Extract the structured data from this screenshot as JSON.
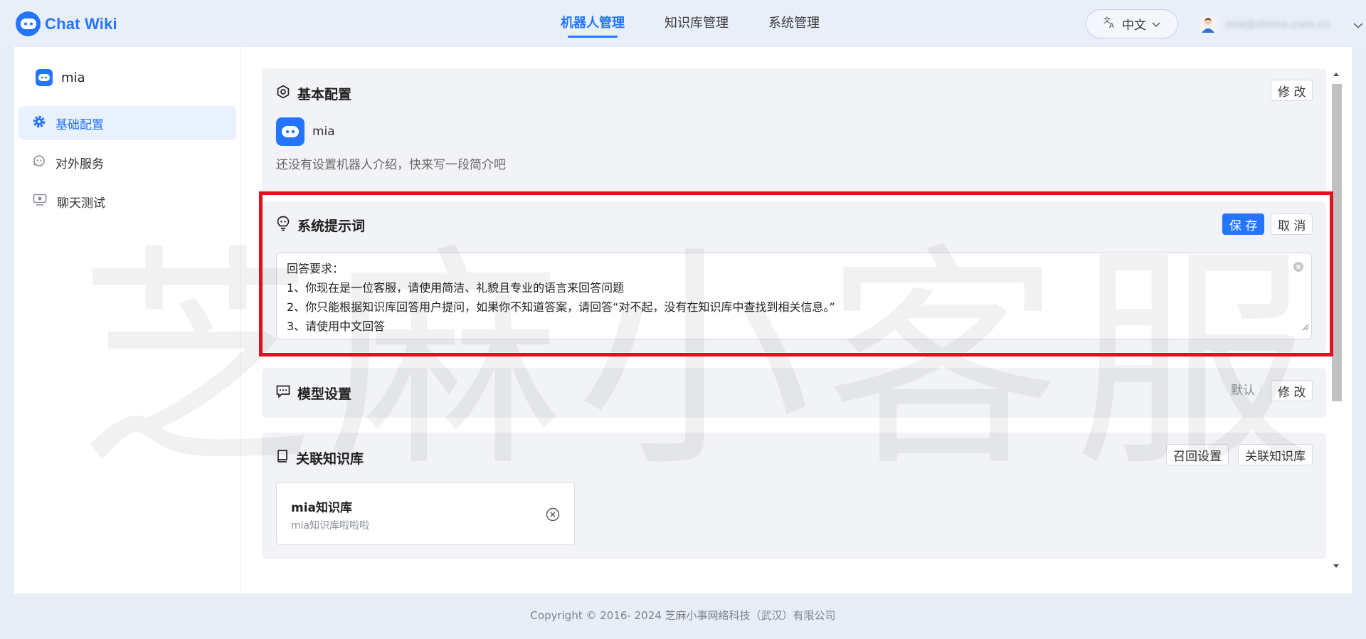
{
  "app": {
    "name": "Chat Wiki"
  },
  "nav": {
    "items": [
      {
        "label": "机器人管理",
        "active": true
      },
      {
        "label": "知识库管理",
        "active": false
      },
      {
        "label": "系统管理",
        "active": false
      }
    ]
  },
  "header": {
    "language": "中文",
    "user_email": "mia@zhima.com.cn"
  },
  "sidebar": {
    "bot_name": "mia",
    "items": [
      {
        "label": "基础配置",
        "active": true,
        "icon": "gear-icon"
      },
      {
        "label": "对外服务",
        "active": false,
        "icon": "service-icon"
      },
      {
        "label": "聊天测试",
        "active": false,
        "icon": "chat-test-icon"
      }
    ]
  },
  "basic": {
    "title": "基本配置",
    "edit_label": "修 改",
    "bot_name": "mia",
    "intro_placeholder": "还没有设置机器人介绍，快来写一段简介吧"
  },
  "prompt": {
    "title": "系统提示词",
    "save_label": "保 存",
    "cancel_label": "取 消",
    "lines": [
      "回答要求：",
      "1、你现在是一位客服，请使用简洁、礼貌且专业的语言来回答问题",
      "2、你只能根据知识库回答用户提问，如果你不知道答案，请回答“对不起，没有在知识库中查找到相关信息。”",
      "3、请使用中文回答"
    ]
  },
  "model": {
    "title": "模型设置",
    "default_label": "默认",
    "edit_label": "修 改"
  },
  "kb": {
    "title": "关联知识库",
    "recall_label": "召回设置",
    "link_label": "关联知识库",
    "items": [
      {
        "name": "mia知识库",
        "desc": "mia知识库啦啦啦"
      }
    ]
  },
  "watermark": "芝麻小客服",
  "footer": "Copyright © 2016- 2024 芝麻小事网络科技（武汉）有限公司",
  "colors": {
    "accent": "#2475fc",
    "highlight": "#e0101e"
  }
}
